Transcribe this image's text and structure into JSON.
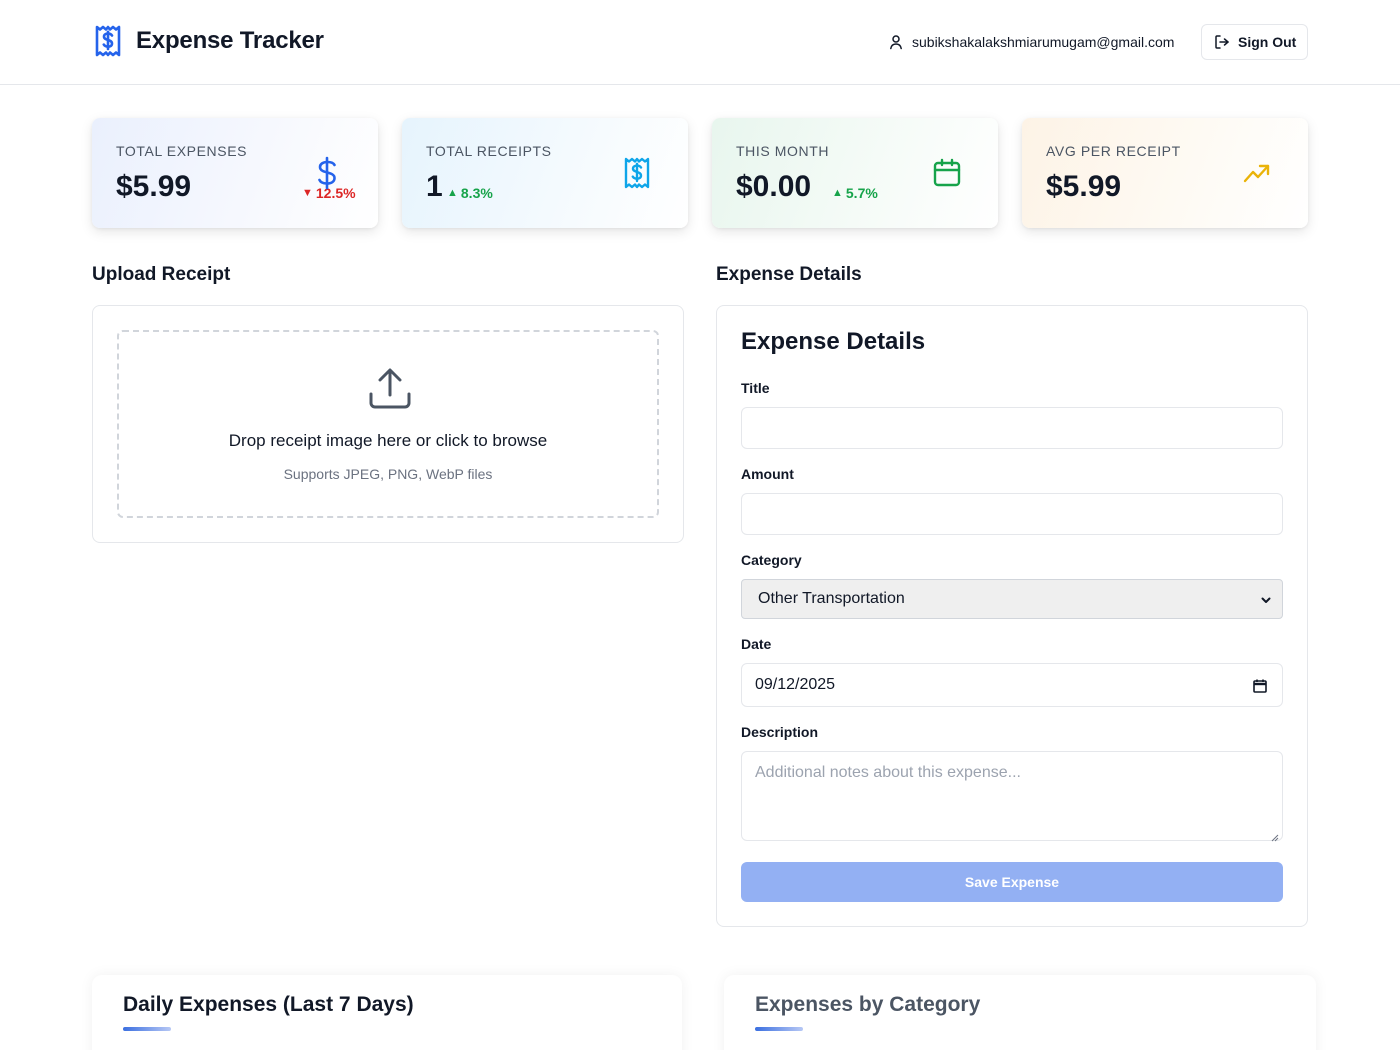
{
  "header": {
    "app_title": "Expense Tracker",
    "user_email": "subikshakalakshmiarumugam@gmail.com",
    "sign_out_label": "Sign Out"
  },
  "stats": [
    {
      "label": "TOTAL EXPENSES",
      "value": "$5.99",
      "change": "12.5%",
      "trend": "down",
      "color": "#dc2626",
      "icon": "dollar-icon"
    },
    {
      "label": "TOTAL RECEIPTS",
      "value": "1",
      "change": "8.3%",
      "trend": "up",
      "color": "#16a34a",
      "icon": "receipt-icon"
    },
    {
      "label": "THIS MONTH",
      "value": "$0.00",
      "change": "5.7%",
      "trend": "up",
      "color": "#16a34a",
      "icon": "calendar-icon"
    },
    {
      "label": "AVG PER RECEIPT",
      "value": "$5.99",
      "icon": "trending-up-icon"
    }
  ],
  "upload": {
    "section_title": "Upload Receipt",
    "drop_text": "Drop receipt image here or click to browse",
    "supported_text": "Supports JPEG, PNG, WebP files"
  },
  "expense_form": {
    "section_title": "Expense Details",
    "heading": "Expense Details",
    "title_label": "Title",
    "title_value": "",
    "amount_label": "Amount",
    "amount_value": "",
    "category_label": "Category",
    "category_selected": "Other Transportation",
    "date_label": "Date",
    "date_value": "09/12/2025",
    "description_label": "Description",
    "description_placeholder": "Additional notes about this expense...",
    "save_label": "Save Expense"
  },
  "charts": {
    "daily_title": "Daily Expenses (Last 7 Days)",
    "category_title": "Expenses by Category"
  },
  "colors": {
    "accent": "#2563eb",
    "save_button": "#93b0f3",
    "negative": "#dc2626",
    "positive": "#16a34a",
    "receipt_icon": "#0ea5e9",
    "trend_icon": "#eab308"
  }
}
